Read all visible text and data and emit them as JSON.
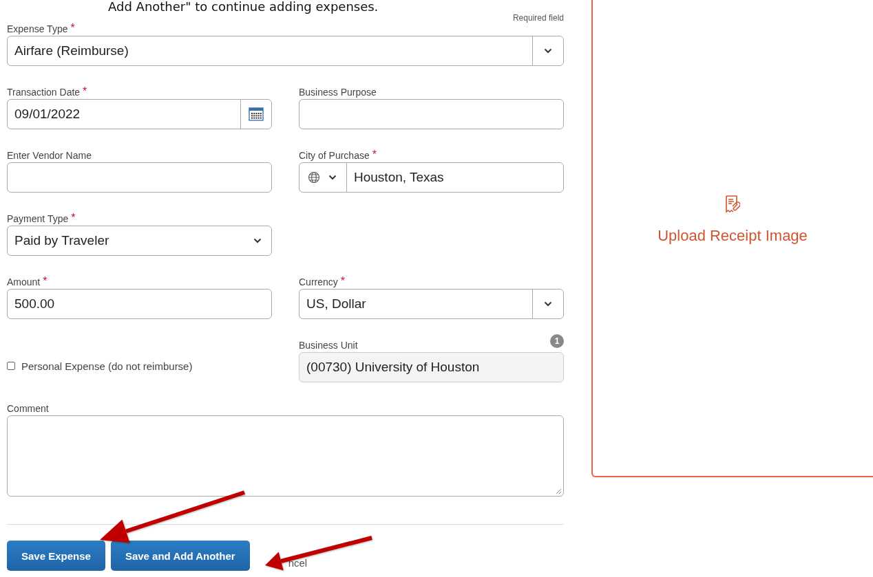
{
  "instruction_text": "Add Another\" to continue adding expenses.",
  "required_note": "Required field",
  "required_mark": "*",
  "fields": [
    {
      "kind": "select",
      "label": "Expense Type",
      "required": true,
      "value": "Airfare (Reimburse)"
    },
    {
      "kind": "date",
      "label": "Transaction Date",
      "required": true,
      "value": "09/01/2022"
    },
    {
      "kind": "text",
      "label": "Business Purpose",
      "required": false
    },
    {
      "kind": "text",
      "label": "Enter Vendor Name",
      "required": false
    },
    {
      "kind": "city",
      "label": "City of Purchase",
      "required": true,
      "value": "Houston, Texas"
    },
    {
      "kind": "dropdown",
      "label": "Payment Type",
      "required": true,
      "value": "Paid by Traveler"
    },
    {
      "kind": "text",
      "label": "Amount",
      "required": true,
      "value": "500.00"
    },
    {
      "kind": "select",
      "label": "Currency",
      "required": true,
      "value": "US, Dollar"
    },
    {
      "kind": "readonly",
      "label": "Business Unit",
      "required": false,
      "value": "(00730) University of Houston",
      "badge": "1"
    }
  ],
  "personal_expense": {
    "label": "Personal Expense (do not reimburse)",
    "checked": false
  },
  "comment": {
    "label": "Comment"
  },
  "buttons": [
    "Save Expense",
    "Save and Add Another"
  ],
  "cancel_link": "ncel",
  "receipt_upload": {
    "label": "Upload Receipt Image"
  }
}
